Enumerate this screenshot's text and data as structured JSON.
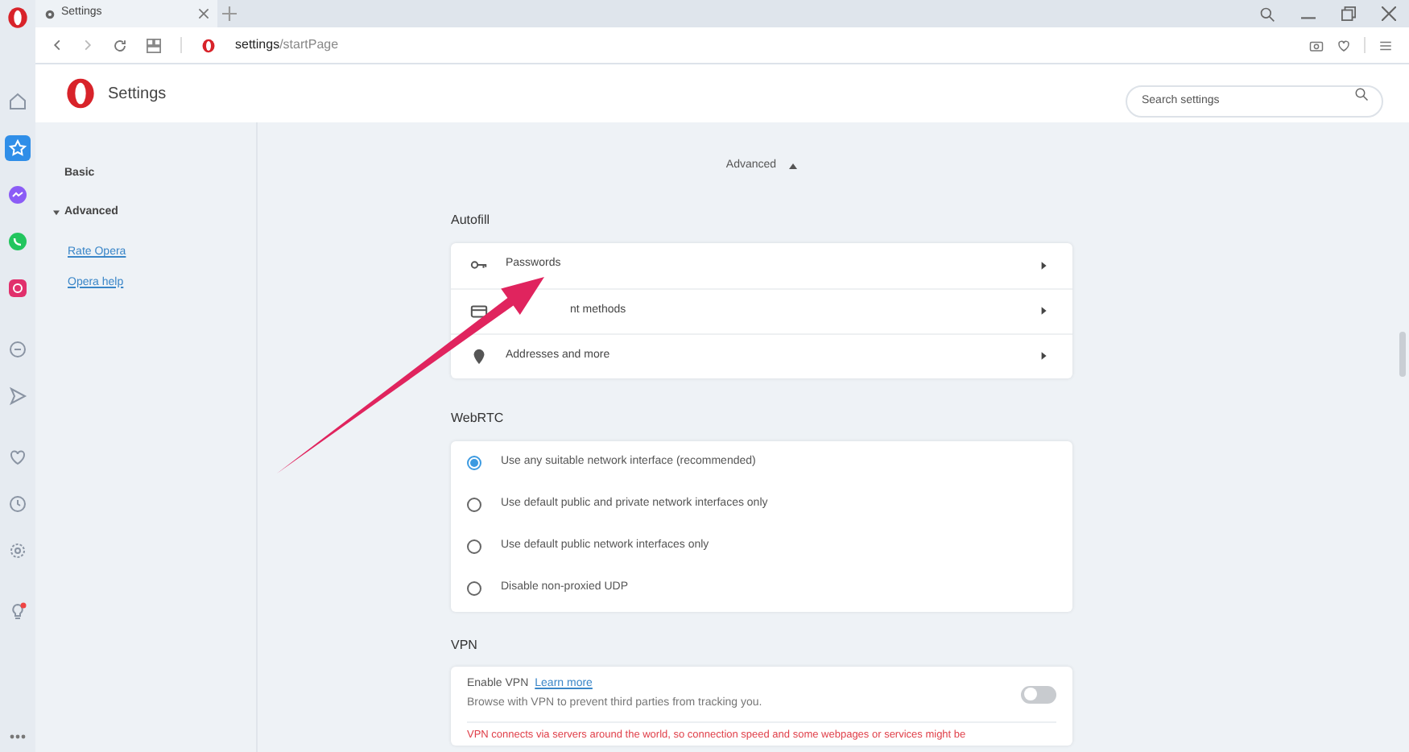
{
  "tab": {
    "title": "Settings"
  },
  "address": {
    "host": "settings",
    "path": "/startPage"
  },
  "sidebar": {
    "items": [
      {
        "kind": "home",
        "selected": false
      },
      {
        "kind": "speed-dial",
        "selected": true
      },
      {
        "kind": "messenger",
        "selected": false
      },
      {
        "kind": "whatsapp",
        "selected": false
      },
      {
        "kind": "instagram",
        "selected": false
      },
      {
        "kind": "circle",
        "selected": false
      },
      {
        "kind": "send",
        "selected": false
      },
      {
        "kind": "heart",
        "selected": false
      },
      {
        "kind": "clock",
        "selected": false
      },
      {
        "kind": "gear",
        "selected": false
      },
      {
        "kind": "bulb",
        "selected": false
      }
    ]
  },
  "header": {
    "title": "Settings",
    "search": {
      "placeholder": "Search settings"
    }
  },
  "nav": {
    "sections": [
      {
        "label": "Basic"
      },
      {
        "label": "Advanced",
        "expanded": true
      }
    ],
    "links": [
      "Rate Opera",
      "Opera help"
    ]
  },
  "advanced_toggle": {
    "label": "Advanced",
    "expanded": true
  },
  "autofill": {
    "title": "Autofill",
    "rows": [
      {
        "kind": "key",
        "label": "Passwords"
      },
      {
        "kind": "card",
        "label": "nt methods"
      },
      {
        "kind": "pin",
        "label": "Addresses and more"
      }
    ]
  },
  "webrtc": {
    "title": "WebRTC",
    "options": [
      {
        "label": "Use any suitable network interface (recommended)",
        "selected": true
      },
      {
        "label": "Use default public and private network interfaces only",
        "selected": false
      },
      {
        "label": "Use default public network interfaces only",
        "selected": false
      },
      {
        "label": "Disable non-proxied UDP",
        "selected": false
      }
    ]
  },
  "vpn": {
    "title": "VPN",
    "setting": "Enable VPN",
    "link": "Learn more",
    "description": "Browse with VPN to prevent third parties from tracking you.",
    "on": false,
    "warning": "VPN connects via servers around the world, so connection speed and some webpages or services might be"
  }
}
